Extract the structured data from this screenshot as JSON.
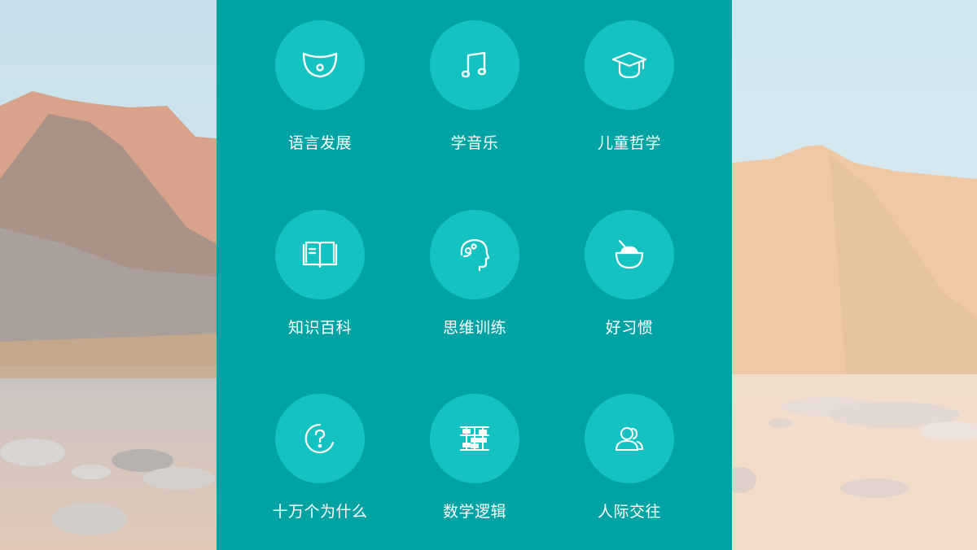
{
  "panel": {
    "background_color": "#00a3a3",
    "circle_color": "#14c2c2",
    "items": [
      {
        "label": "语言发展",
        "icon": "smile-bowl-icon"
      },
      {
        "label": "学音乐",
        "icon": "music-note-icon"
      },
      {
        "label": "儿童哲学",
        "icon": "graduation-cap-icon"
      },
      {
        "label": "知识百科",
        "icon": "open-book-icon"
      },
      {
        "label": "思维训练",
        "icon": "head-thinking-icon"
      },
      {
        "label": "好习惯",
        "icon": "bowl-spoon-icon"
      },
      {
        "label": "十万个为什么",
        "icon": "question-mark-icon"
      },
      {
        "label": "数学逻辑",
        "icon": "abacus-icon"
      },
      {
        "label": "人际交往",
        "icon": "people-icon"
      }
    ]
  }
}
